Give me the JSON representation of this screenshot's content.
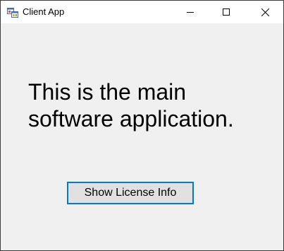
{
  "window": {
    "title": "Client App",
    "icon": "windows-forms-app-icon"
  },
  "caption_buttons": {
    "minimize_icon": "minimize-icon",
    "maximize_icon": "maximize-icon",
    "close_icon": "close-icon"
  },
  "main": {
    "message_line1": "This is the main",
    "message_line2": "software application.",
    "license_button_label": "Show License Info"
  },
  "colors": {
    "client_background": "#f0f0f0",
    "titlebar_background": "#ffffff",
    "button_focus_border": "#0078d7",
    "button_face": "#e1e1e1"
  }
}
